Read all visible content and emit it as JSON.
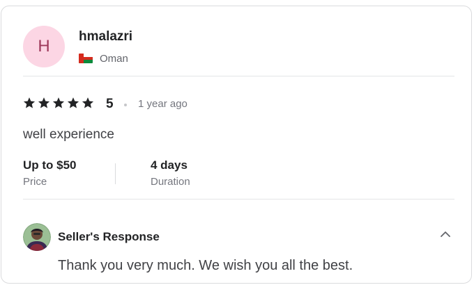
{
  "reviewer": {
    "avatar_initial": "H",
    "username": "hmalazri",
    "country": "Oman",
    "flag_icon": "oman-flag-icon"
  },
  "rating": {
    "stars": 5,
    "value": "5",
    "time_ago": "1 year ago",
    "star_color": "#222325"
  },
  "review": {
    "text": "well experience"
  },
  "stats": [
    {
      "value": "Up to $50",
      "label": "Price"
    },
    {
      "value": "4 days",
      "label": "Duration"
    }
  ],
  "seller_response": {
    "title": "Seller's Response",
    "text": "Thank you very much. We wish you all the best.",
    "toggle_icon": "chevron-up-icon"
  },
  "colors": {
    "avatar_bg": "#fcd6e4",
    "avatar_fg": "#9e3a5b",
    "flag_red": "#d52b1e",
    "flag_white": "#ffffff",
    "flag_green": "#0d8a3b"
  }
}
